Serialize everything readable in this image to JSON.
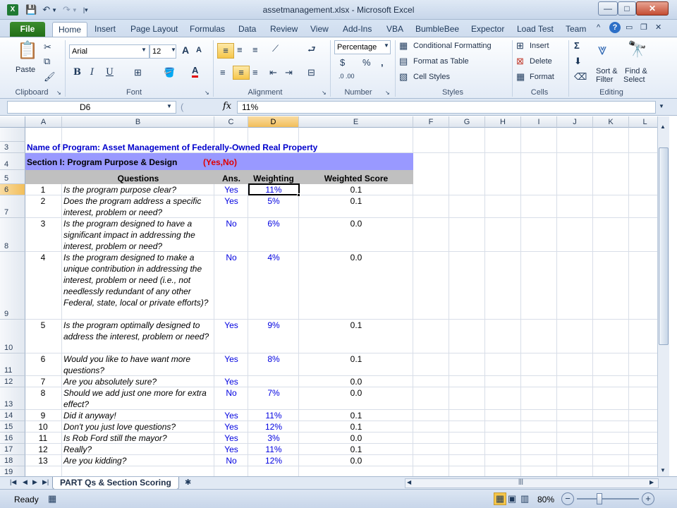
{
  "window": {
    "title": "assetmanagement.xlsx - Microsoft Excel",
    "app_icon": "excel-icon",
    "min": "—",
    "max": "□",
    "close": "✕"
  },
  "tabs": [
    "File",
    "Home",
    "Insert",
    "Page Layout",
    "Formulas",
    "Data",
    "Review",
    "View",
    "Add-Ins",
    "VBA",
    "BumbleBee",
    "Expector",
    "Load Test",
    "Team"
  ],
  "ribbon": {
    "clipboard": {
      "paste": "Paste",
      "label": "Clipboard"
    },
    "font": {
      "name": "Arial",
      "size": "12",
      "label": "Font",
      "bold": "B",
      "italic": "I",
      "underline": "U",
      "grow": "A",
      "shrink": "A"
    },
    "alignment": {
      "label": "Alignment"
    },
    "number": {
      "format": "Percentage",
      "currency": "$",
      "percent": "%",
      "comma": ",",
      "inc": ".0 .00",
      "label": "Number"
    },
    "styles": {
      "cond": "Conditional Formatting",
      "table": "Format as Table",
      "cell": "Cell Styles",
      "label": "Styles"
    },
    "cells": {
      "insert": "Insert",
      "delete": "Delete",
      "format": "Format",
      "label": "Cells"
    },
    "editing": {
      "sigma": "Σ",
      "sort": "Sort &",
      "sort2": "Filter",
      "find": "Find &",
      "find2": "Select",
      "label": "Editing"
    }
  },
  "formula_bar": {
    "cell_ref": "D6",
    "fx": "fx",
    "content": "11%"
  },
  "columns": [
    "A",
    "B",
    "C",
    "D",
    "E",
    "F",
    "G",
    "H",
    "I",
    "J",
    "K",
    "L"
  ],
  "sheet": {
    "row3": "Name of Program:  Asset Management of Federally-Owned Real Property",
    "row4_section": "Section I:  Program Purpose & Design",
    "row4_yesno": "(Yes,No)",
    "headers": {
      "questions": "Questions",
      "ans": "Ans.",
      "weighting": "Weighting",
      "score": "Weighted Score"
    },
    "rows": [
      {
        "row": "6",
        "num": "1",
        "q": "Is the program purpose clear?",
        "ans": "Yes",
        "w": "11%",
        "s": "0.1"
      },
      {
        "row": "7",
        "num": "2",
        "q": "Does the program address a specific interest, problem or need?",
        "ans": "Yes",
        "w": "5%",
        "s": "0.1"
      },
      {
        "row": "8",
        "num": "3",
        "q": "Is the program designed to have a significant impact in addressing the interest, problem or need?",
        "ans": "No",
        "w": "6%",
        "s": "0.0"
      },
      {
        "row": "9",
        "num": "4",
        "q": "Is the program designed to make a unique contribution in addressing the interest, problem or need (i.e., not needlessly redundant of any other Federal, state, local or private efforts)?",
        "ans": "No",
        "w": "4%",
        "s": "0.0"
      },
      {
        "row": "10",
        "num": "5",
        "q": "Is the program optimally designed to address the interest, problem or need?",
        "ans": "Yes",
        "w": "9%",
        "s": "0.1"
      },
      {
        "row": "11",
        "num": "6",
        "q": "Would you like to have want more questions?",
        "ans": "Yes",
        "w": "8%",
        "s": "0.1"
      },
      {
        "row": "12",
        "num": "7",
        "q": "Are you absolutely sure?",
        "ans": "Yes",
        "w": "",
        "s": "0.0"
      },
      {
        "row": "13",
        "num": "8",
        "q": "Should we add just one more for extra effect?",
        "ans": "No",
        "w": "7%",
        "s": "0.0"
      },
      {
        "row": "14",
        "num": "9",
        "q": "Did it anyway!",
        "ans": "Yes",
        "w": "11%",
        "s": "0.1"
      },
      {
        "row": "15",
        "num": "10",
        "q": "Don't you just love questions?",
        "ans": "Yes",
        "w": "12%",
        "s": "0.1"
      },
      {
        "row": "16",
        "num": "11",
        "q": "Is Rob Ford still the mayor?",
        "ans": "Yes",
        "w": "3%",
        "s": "0.0"
      },
      {
        "row": "17",
        "num": "12",
        "q": "Really?",
        "ans": "Yes",
        "w": "11%",
        "s": "0.1"
      },
      {
        "row": "18",
        "num": "13",
        "q": "Are you kidding?",
        "ans": "No",
        "w": "12%",
        "s": "0.0"
      }
    ],
    "row_numbers_top": [
      "3",
      "4",
      "5"
    ],
    "row19": "19"
  },
  "sheet_tab": "PART Qs & Section Scoring",
  "status": {
    "ready": "Ready",
    "zoom": "80%",
    "minus": "−",
    "plus": "+"
  },
  "colors": {
    "section_bg": "#9999ff",
    "header_bg": "#c0c0c0",
    "blue_text": "#0000e0",
    "red_text": "#e00000",
    "title_text": "#0000cc"
  }
}
